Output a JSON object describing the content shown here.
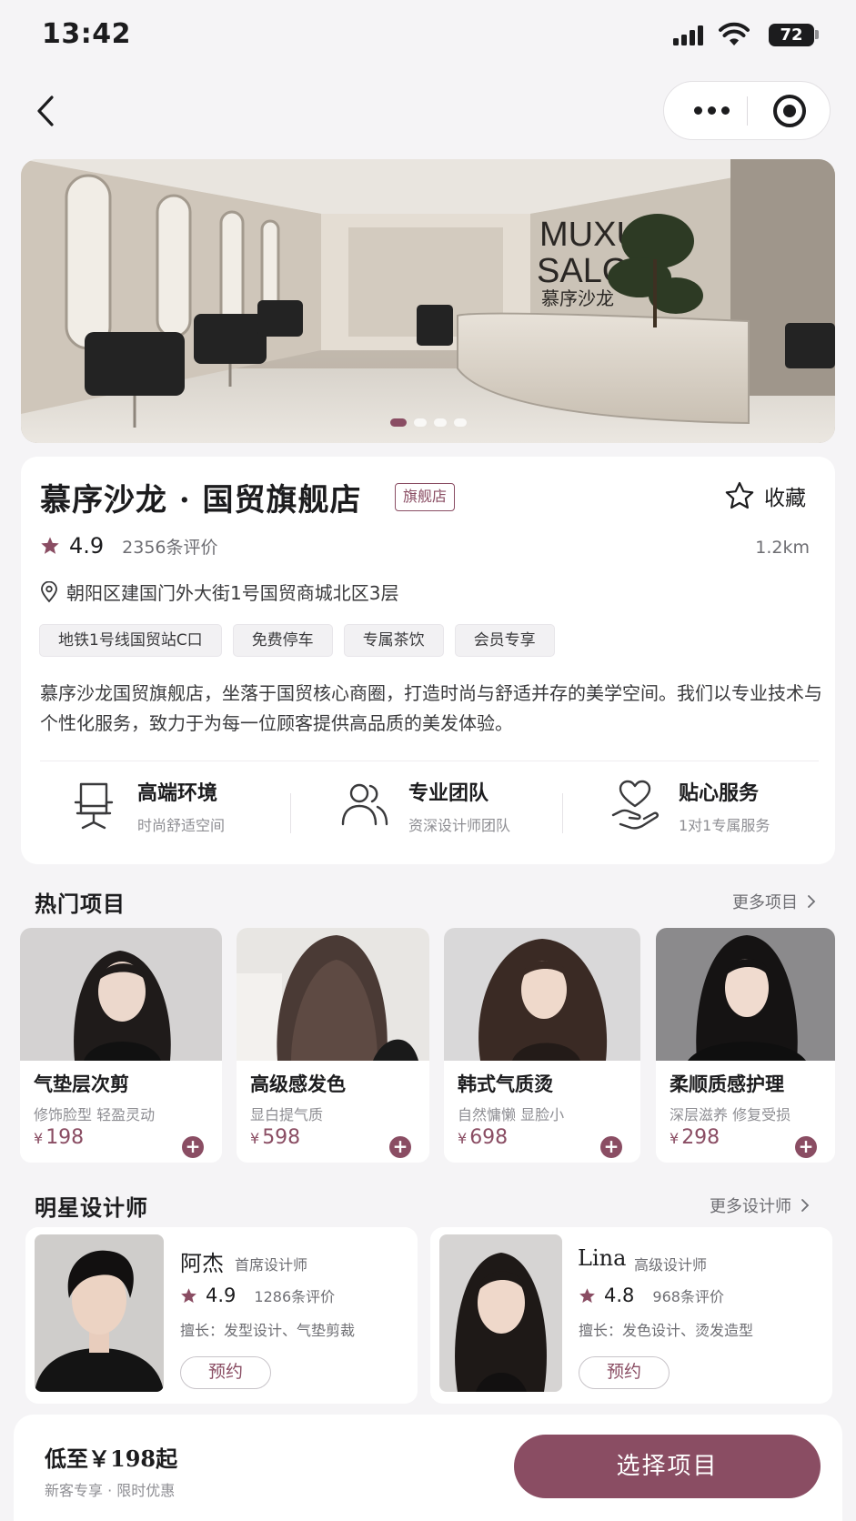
{
  "status_bar": {
    "time": "13:42",
    "battery": "72"
  },
  "hero": {
    "sign_line1": "MUXU",
    "sign_line2": "SALON",
    "sign_line3": "慕序沙龙",
    "slide_count": 4,
    "active_slide": 1
  },
  "store": {
    "name": "慕序沙龙 · 国贸旗舰店",
    "badge": "旗舰店",
    "favorite_label": "收藏",
    "rating": "4.9",
    "reviews": "2356条评价",
    "distance": "1.2km",
    "address": "朝阳区建国门外大街1号国贸商城北区3层",
    "tags": [
      "地铁1号线国贸站C口",
      "免费停车",
      "专属茶饮",
      "会员专享"
    ],
    "description": "慕序沙龙国贸旗舰店，坐落于国贸核心商圈，打造时尚与舒适并存的美学空间。我们以专业技术与个性化服务，致力于为每一位顾客提供高品质的美发体验。"
  },
  "features": [
    {
      "icon": "salon-chair-icon",
      "title": "高端环境",
      "subtitle": "时尚舒适空间"
    },
    {
      "icon": "team-icon",
      "title": "专业团队",
      "subtitle": "资深设计师团队"
    },
    {
      "icon": "heart-hand-icon",
      "title": "贴心服务",
      "subtitle": "1对1专属服务"
    }
  ],
  "hot_projects": {
    "title": "热门项目",
    "more": "更多项目",
    "items": [
      {
        "name": "气垫层次剪",
        "desc": "修饰脸型 轻盈灵动",
        "currency": "¥",
        "price": "198"
      },
      {
        "name": "高级感发色",
        "desc": "显白提气质",
        "currency": "¥",
        "price": "598"
      },
      {
        "name": "韩式气质烫",
        "desc": "自然慵懒 显脸小",
        "currency": "¥",
        "price": "698"
      },
      {
        "name": "柔顺质感护理",
        "desc": "深层滋养 修复受损",
        "currency": "¥",
        "price": "298"
      }
    ]
  },
  "designers": {
    "title": "明星设计师",
    "more": "更多设计师",
    "items": [
      {
        "name": "阿杰",
        "role": "首席设计师",
        "rating": "4.9",
        "reviews": "1286条评价",
        "skills": "擅长：发型设计、气垫剪裁",
        "book": "预约"
      },
      {
        "name": "Lina",
        "role": "高级设计师",
        "rating": "4.8",
        "reviews": "968条评价",
        "skills": "擅长：发色设计、烫发造型",
        "book": "预约"
      }
    ]
  },
  "bottom_bar": {
    "price": "低至￥198起",
    "subtitle": "新客专享 · 限时优惠",
    "cta": "选择项目"
  },
  "colors": {
    "accent": "#8a4d63",
    "background": "#f5f4f6"
  }
}
